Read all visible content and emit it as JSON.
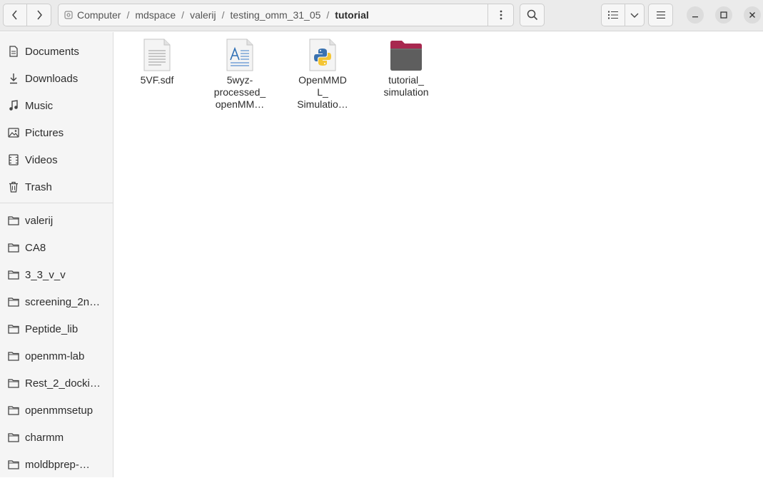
{
  "nav": {
    "back_icon": "chevron-left-icon",
    "forward_icon": "chevron-right-icon"
  },
  "path": {
    "drive_icon": "drive-icon",
    "crumbs": [
      "Computer",
      "mdspace",
      "valerij",
      "testing_omm_31_05",
      "tutorial"
    ],
    "separator": "/",
    "menu_icon": "vertical-dots-icon"
  },
  "toolbar": {
    "search_icon": "search-icon",
    "view_list_icon": "list-view-icon",
    "view_dropdown_icon": "chevron-down-icon",
    "menu_icon": "hamburger-menu-icon"
  },
  "window": {
    "minimize": "minimize-icon",
    "maximize": "maximize-icon",
    "close": "close-icon"
  },
  "sidebar": {
    "places": [
      {
        "label": "Documents",
        "icon": "document-icon"
      },
      {
        "label": "Downloads",
        "icon": "download-icon"
      },
      {
        "label": "Music",
        "icon": "music-icon"
      },
      {
        "label": "Pictures",
        "icon": "picture-icon"
      },
      {
        "label": "Videos",
        "icon": "video-icon"
      },
      {
        "label": "Trash",
        "icon": "trash-icon"
      }
    ],
    "bookmarks": [
      {
        "label": "valerij",
        "icon": "folder-icon"
      },
      {
        "label": "CA8",
        "icon": "folder-icon"
      },
      {
        "label": "3_3_v_v",
        "icon": "folder-icon"
      },
      {
        "label": "screening_2n…",
        "icon": "folder-icon"
      },
      {
        "label": "Peptide_lib",
        "icon": "folder-icon"
      },
      {
        "label": "openmm-lab",
        "icon": "folder-icon"
      },
      {
        "label": "Rest_2_docki…",
        "icon": "folder-icon"
      },
      {
        "label": "openmmsetup",
        "icon": "folder-icon"
      },
      {
        "label": "charmm",
        "icon": "folder-icon"
      },
      {
        "label": "moldbprep-…",
        "icon": "folder-icon"
      }
    ]
  },
  "files": [
    {
      "lines": [
        "5VF.sdf"
      ],
      "icon": "text-file-icon"
    },
    {
      "lines": [
        "5wyz-",
        "processed_",
        "openMM…"
      ],
      "icon": "document-file-icon"
    },
    {
      "lines": [
        "OpenMMD",
        "L_",
        "Simulatio…"
      ],
      "icon": "python-file-icon"
    },
    {
      "lines": [
        "tutorial_",
        "simulation"
      ],
      "icon": "folder-icon"
    }
  ]
}
